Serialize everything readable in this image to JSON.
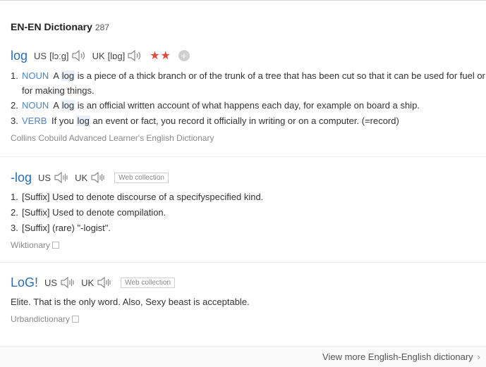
{
  "header": {
    "title": "EN-EN Dictionary",
    "count": "287"
  },
  "entry1": {
    "word": "log",
    "us_label": "US",
    "us_phonetic": "[lɔːg]",
    "uk_label": "UK",
    "uk_phonetic": "[lɒg]",
    "stars": "★★",
    "add": "+",
    "defs": [
      {
        "num": "1.",
        "pos": "NOUN",
        "pre": "A",
        "hl": "log",
        "post": "is a piece of a thick branch or of the trunk of a tree that has been cut so that it can be used for fuel or for making things."
      },
      {
        "num": "2.",
        "pos": "NOUN",
        "pre": "A",
        "hl": "log",
        "post": "is an official written account of what happens each day, for example on board a ship."
      },
      {
        "num": "3.",
        "pos": "VERB",
        "pre": "If you",
        "hl": "log",
        "post": "an event or fact, you record it officially in writing or on a computer. (=record)"
      }
    ],
    "source": "Collins Cobuild Advanced Learner's English Dictionary"
  },
  "entry2": {
    "word": "-log",
    "us_label": "US",
    "uk_label": "UK",
    "tag": "Web collection",
    "defs": [
      {
        "num": "1.",
        "text": "[Suffix] Used to denote discourse of a specifyspecified kind."
      },
      {
        "num": "2.",
        "text": "[Suffix] Used to denote compilation."
      },
      {
        "num": "3.",
        "text": "[Suffix] (rare) \"-logist\"."
      }
    ],
    "source": "Wiktionary"
  },
  "entry3": {
    "word": "LoG!",
    "us_label": "US",
    "uk_label": "UK",
    "tag": "Web collection",
    "def": "Elite. That is the only word. Also, Sexy beast is acceptable.",
    "source": "Urbandictionary"
  },
  "footer": {
    "link": "View more English-English dictionary",
    "chevron": "›"
  },
  "icons": {
    "speaker": "speaker-icon",
    "copy": "copy-icon",
    "plus": "plus-icon"
  },
  "colors": {
    "word": "#2a6fb6",
    "pos": "#4c86c6",
    "stars": "#e24a3b"
  }
}
